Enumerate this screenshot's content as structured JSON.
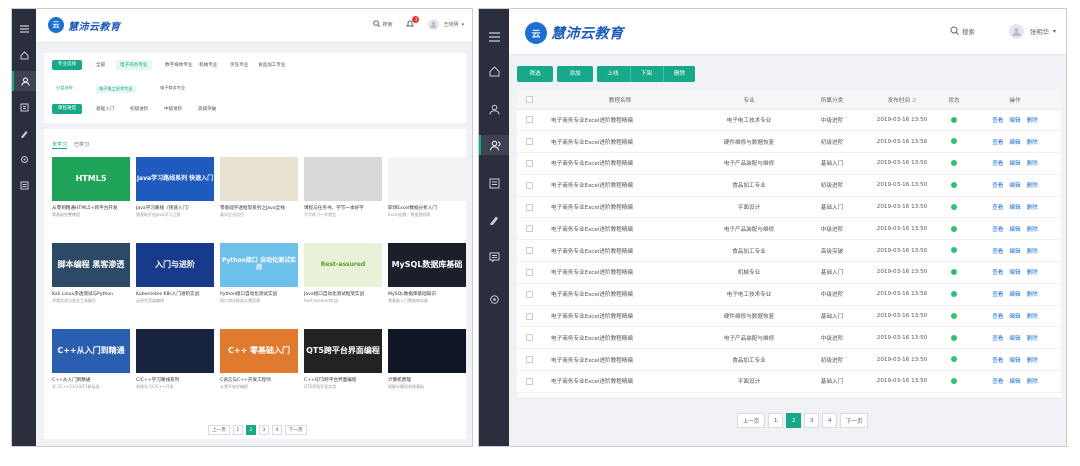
{
  "left": {
    "brand": "慧沛云教育",
    "logo_mark": "云",
    "search_label": "搜索",
    "notif_count": "3",
    "user": "王晓明",
    "filters": {
      "btn1": "专业选择",
      "all": "全部",
      "opts1": [
        "电子商务专业",
        "数字媒体专业",
        "机械专业",
        "烹饪专业",
        "食品加工专业"
      ],
      "btn2": "分类选择",
      "opts2": [
        "电子电工技术专业",
        "电子商务专业"
      ],
      "btn3": "课程难度",
      "opts3": [
        "基础入门",
        "初级进阶",
        "中级进阶",
        "高级突破"
      ]
    },
    "tabs": [
      "未学习",
      "已学习"
    ],
    "courses": [
      {
        "title": "从零到精通HTML5+跨平台开发",
        "desc": "零基础完整教程",
        "thumb": "HTML5",
        "bg": "#1fa45a",
        "color": "#fff"
      },
      {
        "title": "Java学习路线（快速入门）",
        "desc": "零基础开启Java学习之旅",
        "thumb": "Java学习路线系列 快速入门",
        "bg": "#1f5bbf",
        "color": "#fff"
      },
      {
        "title": "零基础学透框架系列之Java全栈",
        "desc": "真实企业项目",
        "thumb": "",
        "bg": "#e9e2d2",
        "color": "#555"
      },
      {
        "title": "课程与任务书，学写一本好字",
        "desc": "写字练习一学就会",
        "thumb": "",
        "bg": "#d9d9d9",
        "color": "#555"
      },
      {
        "title": "职场Excel数据分析入门",
        "desc": "Excel函数、数据透视表",
        "thumb": "",
        "bg": "#f3f3f3",
        "color": "#555"
      },
      {
        "title": "Kali Linux渗透测试与Python",
        "desc": "渗透实战与安全工具编写",
        "thumb": "脚本编程 黑客渗透",
        "bg": "#2c4a66",
        "color": "#fff"
      },
      {
        "title": "Kubernetes K8s入门进阶实战",
        "desc": "云原生容器编排",
        "thumb": "入门与进阶",
        "bg": "#173b8a",
        "color": "#fff"
      },
      {
        "title": "Python接口自动化测试实战",
        "desc": "接口测试框架从零搭建",
        "thumb": "Python接口 自动化测试实战",
        "bg": "#6dc0ea",
        "color": "#fff"
      },
      {
        "title": "Java接口自动化测试框架实战",
        "desc": "Rest-assured实战",
        "thumb": "Rest-assured",
        "bg": "#e8f2d8",
        "color": "#5a9a2a"
      },
      {
        "title": "MySQL数据库基础知识",
        "desc": "零基础入门数据库必备",
        "thumb": "MySQL数据库基础",
        "bg": "#1b1f2a",
        "color": "#fff"
      },
      {
        "title": "C++从入门到精通",
        "desc": "学习C++11/14/17新标准",
        "thumb": "C++从入门到精通",
        "bg": "#2a5fb0",
        "color": "#fff"
      },
      {
        "title": "C/C++学习路线系列",
        "desc": "系统学习C/C++开发",
        "thumb": "",
        "bg": "#18233f",
        "color": "#fff"
      },
      {
        "title": "C语言与C++开发工程师",
        "desc": "从零开始学编程",
        "thumb": "C++ 零基础入门",
        "bg": "#e07a2e",
        "color": "#fff"
      },
      {
        "title": "C++QT5跨平台界面编程",
        "desc": "QT5界面开发实战",
        "thumb": "QT5跨平台界面编程",
        "bg": "#222",
        "color": "#fff"
      },
      {
        "title": "计算机原理",
        "desc": "理解计算机系统基础",
        "thumb": "",
        "bg": "#0f1626",
        "color": "#8ff"
      }
    ],
    "pagination": {
      "prev": "上一页",
      "pages": [
        "1",
        "2",
        "3",
        "4"
      ],
      "active": "2",
      "next": "下一页"
    }
  },
  "right": {
    "brand": "慧沛云教育",
    "logo_mark": "云",
    "search_label": "搜索",
    "user": "张明华",
    "toolbar": [
      "筛选",
      "添加",
      "上线",
      "下架",
      "删除"
    ],
    "headers": [
      "教程名称",
      "专业",
      "所属分类",
      "发布时间",
      "状态",
      "操作"
    ],
    "ops": [
      "查看",
      "编辑",
      "删除"
    ],
    "rows": [
      [
        "电子商务专业Excel进阶教程精编",
        "电子电工技术专业",
        "中级进阶",
        "2019-03-16 13:50"
      ],
      [
        "电子商务专业Excel进阶教程精编",
        "硬件维修与数据恢复",
        "初级进阶",
        "2019-03-16 13:50"
      ],
      [
        "电子商务专业Excel进阶教程精编",
        "电子产品装配与维修",
        "基础入门",
        "2019-03-16 13:50"
      ],
      [
        "电子商务专业Excel进阶教程精编",
        "食品加工专业",
        "初级进阶",
        "2019-03-16 13:50"
      ],
      [
        "电子商务专业Excel进阶教程精编",
        "平面设计",
        "基础入门",
        "2019-03-16 13:50"
      ],
      [
        "电子商务专业Excel进阶教程精编",
        "电子产品装配与维修",
        "中级进阶",
        "2019-03-16 13:50"
      ],
      [
        "电子商务专业Excel进阶教程精编",
        "食品加工专业",
        "高级突破",
        "2019-03-16 13:50"
      ],
      [
        "电子商务专业Excel进阶教程精编",
        "机械专业",
        "基础入门",
        "2019-03-16 13:50"
      ],
      [
        "电子商务专业Excel进阶教程精编",
        "电子电工技术专业",
        "中级进阶",
        "2019-03-16 13:50"
      ],
      [
        "电子商务专业Excel进阶教程精编",
        "硬件维修与数据恢复",
        "基础入门",
        "2019-03-16 13:50"
      ],
      [
        "电子商务专业Excel进阶教程精编",
        "电子产品装配与维修",
        "中级进阶",
        "2019-03-16 13:50"
      ],
      [
        "电子商务专业Excel进阶教程精编",
        "食品加工专业",
        "初级进阶",
        "2019-03-16 13:50"
      ],
      [
        "电子商务专业Excel进阶教程精编",
        "平面设计",
        "基础入门",
        "2019-03-16 13:50"
      ]
    ],
    "pagination": {
      "prev": "上一页",
      "pages": [
        "1",
        "2",
        "3",
        "4"
      ],
      "active": "2",
      "next": "下一页"
    }
  },
  "colors": {
    "accent": "#18a88a",
    "sidebar": "#2b2f3d",
    "brand": "#1a5aba",
    "link": "#1d6fd1",
    "status": "#2ec36e"
  },
  "icons": {
    "sidebar": [
      "menu-icon",
      "home-icon",
      "user-icon",
      "book-icon",
      "pen-icon",
      "settings-icon",
      "list-icon"
    ]
  }
}
